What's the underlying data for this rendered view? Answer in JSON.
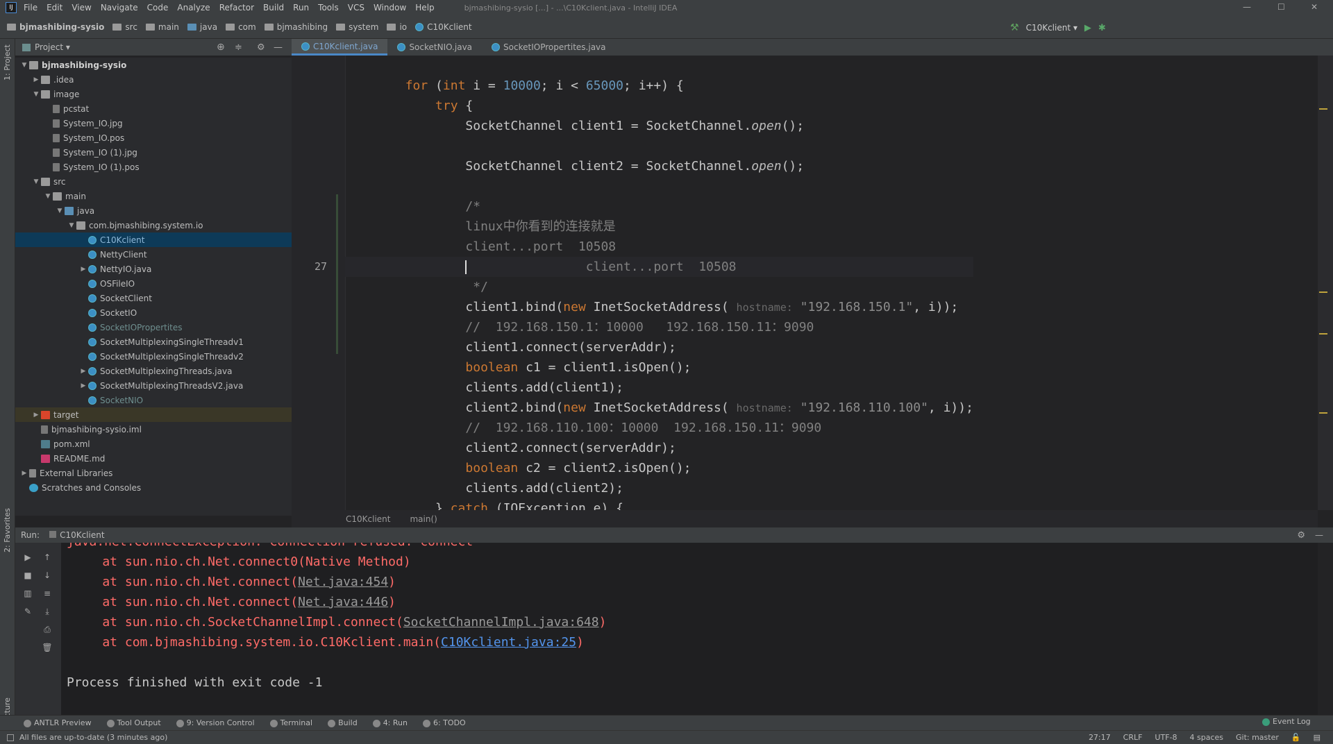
{
  "menubar": {
    "items": [
      "File",
      "Edit",
      "View",
      "Navigate",
      "Code",
      "Analyze",
      "Refactor",
      "Build",
      "Run",
      "Tools",
      "VCS",
      "Window",
      "Help"
    ],
    "window_title": "bjmashibing-sysio [...] - ...\\C10Kclient.java - IntelliJ IDEA",
    "minimize": "—",
    "maximize": "☐",
    "close": "✕"
  },
  "navbar": {
    "crumbs": [
      {
        "label": "bjmashibing-sysio",
        "icon": "project-folder-icon"
      },
      {
        "label": "src",
        "icon": "folder-icon"
      },
      {
        "label": "main",
        "icon": "folder-icon"
      },
      {
        "label": "java",
        "icon": "source-folder-icon"
      },
      {
        "label": "com",
        "icon": "folder-icon"
      },
      {
        "label": "bjmashibing",
        "icon": "folder-icon"
      },
      {
        "label": "system",
        "icon": "folder-icon"
      },
      {
        "label": "io",
        "icon": "folder-icon"
      },
      {
        "label": "C10Kclient",
        "icon": "class-icon"
      }
    ],
    "run_config": "C10Kclient"
  },
  "left_stripe": {
    "project": "1: Project",
    "favorites": "2: Favorites",
    "structure": "Z: Structure"
  },
  "project_panel": {
    "title": "Project",
    "tree": [
      {
        "label": "bjmashibing-sysio",
        "level": 0,
        "arrow": "▼",
        "icon": "folder",
        "bold": true
      },
      {
        "label": ".idea",
        "level": 1,
        "arrow": "▶",
        "icon": "folder"
      },
      {
        "label": "image",
        "level": 1,
        "arrow": "▼",
        "icon": "folder"
      },
      {
        "label": "pcstat",
        "level": 2,
        "icon": "file"
      },
      {
        "label": "System_IO.jpg",
        "level": 2,
        "icon": "file"
      },
      {
        "label": "System_IO.pos",
        "level": 2,
        "icon": "file"
      },
      {
        "label": "System_IO (1).jpg",
        "level": 2,
        "icon": "file"
      },
      {
        "label": "System_IO (1).pos",
        "level": 2,
        "icon": "file"
      },
      {
        "label": "src",
        "level": 1,
        "arrow": "▼",
        "icon": "folder"
      },
      {
        "label": "main",
        "level": 2,
        "arrow": "▼",
        "icon": "folder"
      },
      {
        "label": "java",
        "level": 3,
        "arrow": "▼",
        "icon": "srcf"
      },
      {
        "label": "com.bjmashibing.system.io",
        "level": 4,
        "arrow": "▼",
        "icon": "folder"
      },
      {
        "label": "C10Kclient",
        "level": 5,
        "icon": "cls",
        "selected": true
      },
      {
        "label": "NettyClient",
        "level": 5,
        "icon": "cls"
      },
      {
        "label": "NettyIO.java",
        "level": 5,
        "arrow": "▶",
        "icon": "cls"
      },
      {
        "label": "OSFileIO",
        "level": 5,
        "icon": "cls"
      },
      {
        "label": "SocketClient",
        "level": 5,
        "icon": "cls"
      },
      {
        "label": "SocketIO",
        "level": 5,
        "icon": "cls"
      },
      {
        "label": "SocketIOPropertites",
        "level": 5,
        "icon": "cls",
        "dim": true
      },
      {
        "label": "SocketMultiplexingSingleThreadv1",
        "level": 5,
        "icon": "cls"
      },
      {
        "label": "SocketMultiplexingSingleThreadv2",
        "level": 5,
        "icon": "cls"
      },
      {
        "label": "SocketMultiplexingThreads.java",
        "level": 5,
        "arrow": "▶",
        "icon": "cls"
      },
      {
        "label": "SocketMultiplexingThreadsV2.java",
        "level": 5,
        "arrow": "▶",
        "icon": "cls"
      },
      {
        "label": "SocketNIO",
        "level": 5,
        "icon": "cls",
        "dim": true
      },
      {
        "label": "target",
        "level": 1,
        "arrow": "▶",
        "icon": "red",
        "target": true
      },
      {
        "label": "bjmashibing-sysio.iml",
        "level": 1,
        "icon": "file"
      },
      {
        "label": "pom.xml",
        "level": 1,
        "icon": "xml"
      },
      {
        "label": "README.md",
        "level": 1,
        "icon": "md"
      },
      {
        "label": "External Libraries",
        "level": 0,
        "arrow": "▶",
        "icon": "lib"
      },
      {
        "label": "Scratches and Consoles",
        "level": 0,
        "icon": "scr"
      }
    ]
  },
  "editor": {
    "tabs": [
      {
        "label": "C10Kclient.java",
        "active": true
      },
      {
        "label": "SocketNIO.java"
      },
      {
        "label": "SocketIOPropertites.java"
      }
    ],
    "current_line_number": "27",
    "lines": [
      [
        [
          "        ",
          ""
        ],
        [
          "for",
          "k"
        ],
        [
          " (",
          ""
        ],
        [
          "int",
          "k"
        ],
        [
          " i = ",
          ""
        ],
        [
          "10000",
          "n"
        ],
        [
          "; i < ",
          ""
        ],
        [
          "65000",
          "n"
        ],
        [
          "; i++) {",
          ""
        ]
      ],
      [
        [
          "            ",
          ""
        ],
        [
          "try",
          "k"
        ],
        [
          " {",
          ""
        ]
      ],
      [
        [
          "                SocketChannel client1 = SocketChannel.",
          ""
        ],
        [
          "open",
          "i"
        ],
        [
          "();",
          ""
        ]
      ],
      [],
      [
        [
          "                SocketChannel client2 = SocketChannel.",
          ""
        ],
        [
          "open",
          "i"
        ],
        [
          "();",
          ""
        ]
      ],
      [],
      [
        [
          "                /*",
          "c"
        ]
      ],
      [
        [
          "                linux中你看到的连接就是",
          "c"
        ]
      ],
      [
        [
          "                client...port  10508",
          "c"
        ]
      ],
      [
        [
          "                client...port  10508",
          "c"
        ]
      ],
      [
        [
          "                 */",
          "c"
        ]
      ],
      [
        [
          "                client1.bind(",
          ""
        ],
        [
          "new",
          "k"
        ],
        [
          " InetSocketAddress( ",
          ""
        ],
        [
          "hostname:",
          "h"
        ],
        [
          " ",
          ""
        ],
        [
          "\"192.168.150.1\"",
          "s"
        ],
        [
          ", i));",
          ""
        ]
      ],
      [
        [
          "                //  192.168.150.1：10000   192.168.150.11：9090",
          "c"
        ]
      ],
      [
        [
          "                client1.connect(serverAddr);",
          ""
        ]
      ],
      [
        [
          "                ",
          ""
        ],
        [
          "boolean",
          "k"
        ],
        [
          " c1 = client1.isOpen();",
          ""
        ]
      ],
      [
        [
          "                clients.add(client1);",
          ""
        ]
      ],
      [
        [
          "                client2.bind(",
          ""
        ],
        [
          "new",
          "k"
        ],
        [
          " InetSocketAddress( ",
          ""
        ],
        [
          "hostname:",
          "h"
        ],
        [
          " ",
          ""
        ],
        [
          "\"192.168.110.100\"",
          "s"
        ],
        [
          ", i));",
          ""
        ]
      ],
      [
        [
          "                //  192.168.110.100：10000  192.168.150.11：9090",
          "c"
        ]
      ],
      [
        [
          "                client2.connect(serverAddr);",
          ""
        ]
      ],
      [
        [
          "                ",
          ""
        ],
        [
          "boolean",
          "k"
        ],
        [
          " c2 = client2.isOpen();",
          ""
        ]
      ],
      [
        [
          "                clients.add(client2);",
          ""
        ]
      ],
      [
        [
          "            } ",
          ""
        ],
        [
          "catch",
          "k"
        ],
        [
          " (IOException e) {",
          ""
        ]
      ]
    ],
    "breadcrumb": [
      "C10Kclient",
      "main()"
    ]
  },
  "run_panel": {
    "label": "Run:",
    "config": "C10Kclient",
    "console": [
      [
        [
          "java.net.ConnectException: Connection refused: connect",
          ""
        ]
      ],
      [
        [
          "    at sun.nio.ch.Net.connect0(Native Method)",
          ""
        ]
      ],
      [
        [
          "    at sun.nio.ch.Net.connect(",
          ""
        ],
        [
          "Net.java:454",
          "lk"
        ],
        [
          ")",
          ""
        ]
      ],
      [
        [
          "    at sun.nio.ch.Net.connect(",
          ""
        ],
        [
          "Net.java:446",
          "lk"
        ],
        [
          ")",
          ""
        ]
      ],
      [
        [
          "    at sun.nio.ch.SocketChannelImpl.connect(",
          ""
        ],
        [
          "SocketChannelImpl.java:648",
          "lk"
        ],
        [
          ")",
          ""
        ]
      ],
      [
        [
          "    at com.bjmashibing.system.io.C10Kclient.main(",
          ""
        ],
        [
          "C10Kclient.java:25",
          "bl"
        ],
        [
          ")",
          ""
        ]
      ],
      [],
      [
        [
          "Process finished with exit code -1",
          "norm"
        ]
      ]
    ]
  },
  "tool_windows": [
    "ANTLR Preview",
    "Tool Output",
    "9: Version Control",
    "Terminal",
    "Build",
    "4: Run",
    "6: TODO"
  ],
  "status": {
    "message": "All files are up-to-date (3 minutes ago)",
    "position": "27:17",
    "line_sep": "CRLF",
    "encoding": "UTF-8",
    "indent": "4 spaces",
    "vcs": "Git: master",
    "event_log": "Event Log"
  }
}
